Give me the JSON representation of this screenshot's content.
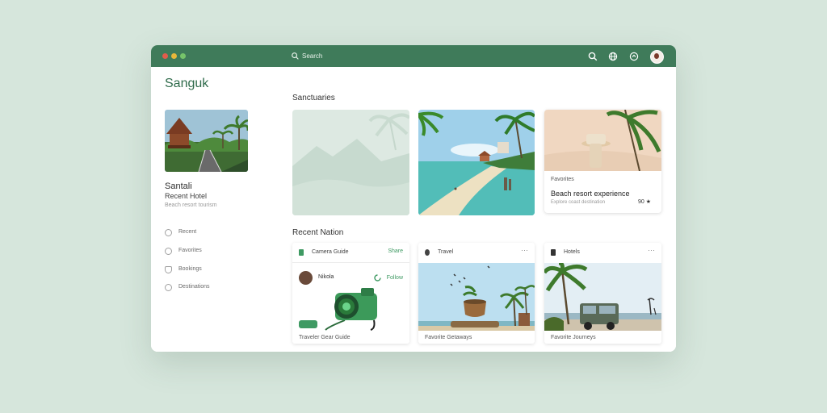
{
  "window": {
    "search": {
      "placeholder": "Search"
    },
    "toolbar_icons": [
      "search-icon",
      "globe-icon",
      "share-icon",
      "profile-avatar"
    ]
  },
  "sidebar": {
    "brand": "Sanguk",
    "profile": {
      "name": "Santali",
      "role": "Recent Hotel",
      "sub": "Beach resort tourism"
    },
    "nav": [
      {
        "label": "Recent",
        "icon": "circle-icon"
      },
      {
        "label": "Favorites",
        "icon": "circle-icon"
      },
      {
        "label": "Bookings",
        "icon": "shield-icon"
      },
      {
        "label": "Destinations",
        "icon": "circle-icon"
      }
    ]
  },
  "main": {
    "section1_title": "Sanctuaries",
    "featured": {
      "label": "Favorites",
      "title": "Beach resort experience",
      "sub": "Explore coast destination",
      "rating": "90 ★"
    },
    "section2_title": "Recent Nation",
    "cards": [
      {
        "header": "Camera Guide",
        "link": "Share",
        "user": "Nikola",
        "action": "Follow",
        "footer": "Traveler Gear Guide"
      },
      {
        "header": "Travel",
        "footer": "Favorite Getaways"
      },
      {
        "header": "Hotels",
        "footer": "Favorite Journeys"
      }
    ]
  },
  "colors": {
    "accent": "#3f7b5a",
    "background": "#d6e6dc",
    "link": "#3f9a63"
  }
}
